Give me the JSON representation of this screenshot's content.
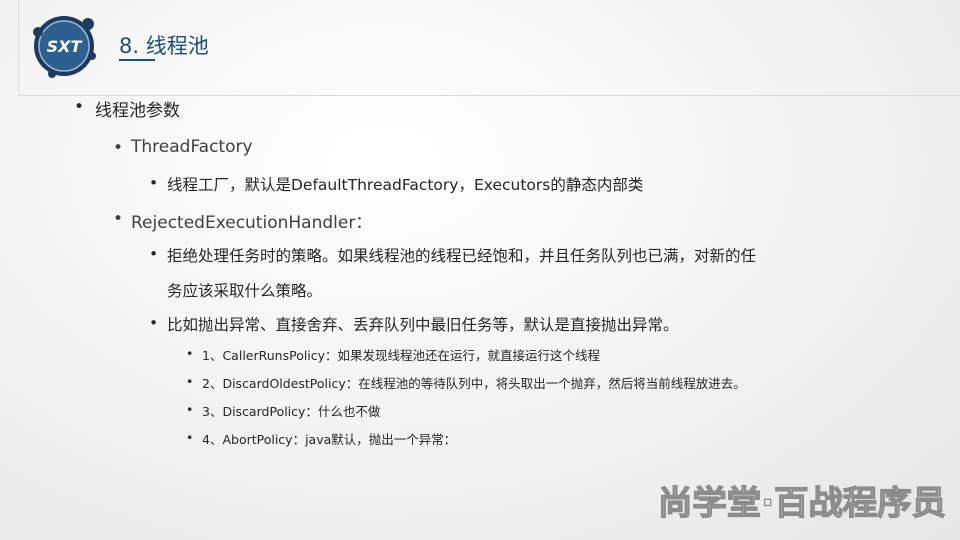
{
  "logo": {
    "text": "SXT",
    "colors": {
      "ring": "#1f3a5f",
      "face": "#2d5f8f",
      "text": "#ffffff"
    }
  },
  "header": {
    "title": "8. 线程池"
  },
  "content": {
    "l1": "线程池参数",
    "thread_factory": {
      "heading": "ThreadFactory",
      "detail": "线程工厂，默认是DefaultThreadFactory，Executors的静态内部类"
    },
    "rejected": {
      "heading": "RejectedExecutionHandler：",
      "desc_line1": "拒绝处理任务时的策略。如果线程池的线程已经饱和，并且任务队列也已满，对新的任",
      "desc_line2": "务应该采取什么策略。",
      "default_line": "比如抛出异常、直接舍弃、丢弃队列中最旧任务等，默认是直接抛出异常。",
      "policies": [
        "1、CallerRunsPolicy：如果发现线程池还在运行，就直接运行这个线程",
        "2、DiscardOldestPolicy：在线程池的等待队列中，将头取出一个抛弃，然后将当前线程放进去。",
        "3、DiscardPolicy：什么也不做",
        "4、AbortPolicy：java默认，抛出一个异常："
      ]
    }
  },
  "watermark": {
    "text": "尚学堂·百战程序员"
  },
  "bullet_char": "•"
}
